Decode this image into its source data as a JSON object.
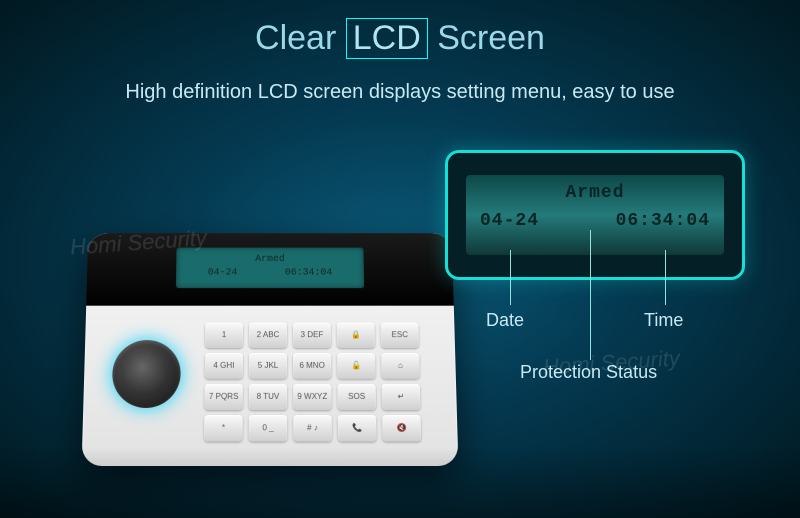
{
  "title": {
    "pre": "Clear",
    "mid": "LCD",
    "post": "Screen"
  },
  "subtitle": "High definition LCD screen displays setting menu, easy to use",
  "lcd": {
    "status": "Armed",
    "date": "04-24",
    "time": "06:34:04"
  },
  "labels": {
    "date": "Date",
    "time": "Time",
    "status": "Protection Status"
  },
  "keys": [
    "1",
    "2 ABC",
    "3 DEF",
    "🔒",
    "ESC",
    "4 GHI",
    "5 JKL",
    "6 MNO",
    "🔓",
    "⌂",
    "7 PQRS",
    "8 TUV",
    "9 WXYZ",
    "SOS",
    "↵",
    "*",
    "0 _",
    "# ♪",
    "📞",
    "🔇"
  ],
  "watermark": "Homi Security"
}
